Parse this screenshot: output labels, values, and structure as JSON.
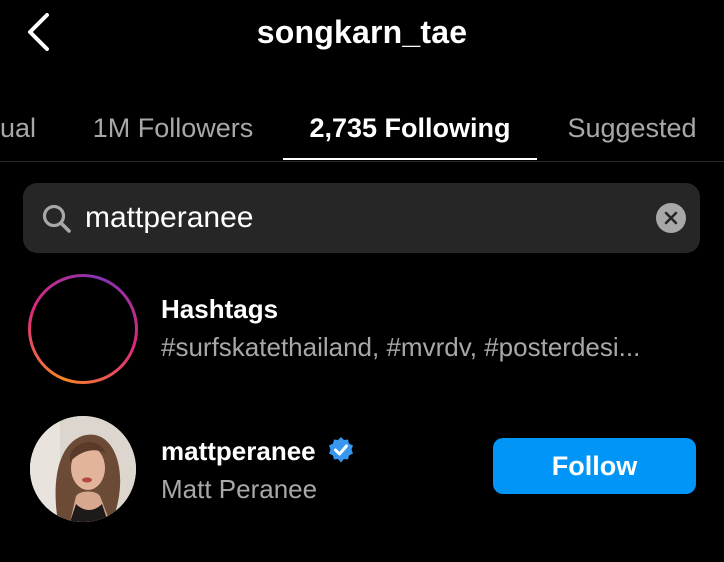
{
  "header": {
    "title": "songkarn_tae",
    "back_icon": "chevron-left-icon"
  },
  "tabs": [
    {
      "label": "ual",
      "active": false
    },
    {
      "label": "1M Followers",
      "active": false
    },
    {
      "label": "2,735 Following",
      "active": true
    },
    {
      "label": "Suggested",
      "active": false
    }
  ],
  "search": {
    "value": "mattperanee",
    "icon": "search-icon",
    "clear_icon": "clear-icon"
  },
  "results": {
    "hashtags": {
      "title": "Hashtags",
      "subtitle": "#surfskatethailand, #mvrdv, #posterdesi...",
      "icon": "hashtag-icon"
    },
    "user": {
      "username": "mattperanee",
      "full_name": "Matt Peranee",
      "verified": true,
      "verified_icon": "verified-badge-icon",
      "follow_label": "Follow"
    }
  },
  "colors": {
    "background": "#000000",
    "primary_text": "#ffffff",
    "secondary_text": "#a8a8a8",
    "search_bg": "#262626",
    "follow_button": "#0095f6",
    "verified_badge": "#3897f0"
  }
}
